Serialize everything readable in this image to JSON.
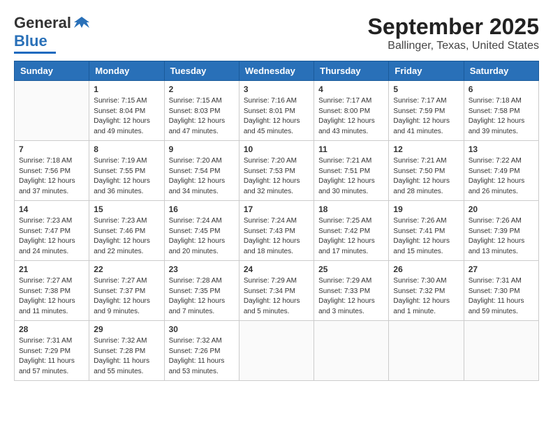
{
  "header": {
    "logo_line1": "General",
    "logo_line2": "Blue",
    "title": "September 2025",
    "subtitle": "Ballinger, Texas, United States"
  },
  "days_of_week": [
    "Sunday",
    "Monday",
    "Tuesday",
    "Wednesday",
    "Thursday",
    "Friday",
    "Saturday"
  ],
  "weeks": [
    [
      {
        "day": "",
        "content": ""
      },
      {
        "day": "1",
        "content": "Sunrise: 7:15 AM\nSunset: 8:04 PM\nDaylight: 12 hours\nand 49 minutes."
      },
      {
        "day": "2",
        "content": "Sunrise: 7:15 AM\nSunset: 8:03 PM\nDaylight: 12 hours\nand 47 minutes."
      },
      {
        "day": "3",
        "content": "Sunrise: 7:16 AM\nSunset: 8:01 PM\nDaylight: 12 hours\nand 45 minutes."
      },
      {
        "day": "4",
        "content": "Sunrise: 7:17 AM\nSunset: 8:00 PM\nDaylight: 12 hours\nand 43 minutes."
      },
      {
        "day": "5",
        "content": "Sunrise: 7:17 AM\nSunset: 7:59 PM\nDaylight: 12 hours\nand 41 minutes."
      },
      {
        "day": "6",
        "content": "Sunrise: 7:18 AM\nSunset: 7:58 PM\nDaylight: 12 hours\nand 39 minutes."
      }
    ],
    [
      {
        "day": "7",
        "content": "Sunrise: 7:18 AM\nSunset: 7:56 PM\nDaylight: 12 hours\nand 37 minutes."
      },
      {
        "day": "8",
        "content": "Sunrise: 7:19 AM\nSunset: 7:55 PM\nDaylight: 12 hours\nand 36 minutes."
      },
      {
        "day": "9",
        "content": "Sunrise: 7:20 AM\nSunset: 7:54 PM\nDaylight: 12 hours\nand 34 minutes."
      },
      {
        "day": "10",
        "content": "Sunrise: 7:20 AM\nSunset: 7:53 PM\nDaylight: 12 hours\nand 32 minutes."
      },
      {
        "day": "11",
        "content": "Sunrise: 7:21 AM\nSunset: 7:51 PM\nDaylight: 12 hours\nand 30 minutes."
      },
      {
        "day": "12",
        "content": "Sunrise: 7:21 AM\nSunset: 7:50 PM\nDaylight: 12 hours\nand 28 minutes."
      },
      {
        "day": "13",
        "content": "Sunrise: 7:22 AM\nSunset: 7:49 PM\nDaylight: 12 hours\nand 26 minutes."
      }
    ],
    [
      {
        "day": "14",
        "content": "Sunrise: 7:23 AM\nSunset: 7:47 PM\nDaylight: 12 hours\nand 24 minutes."
      },
      {
        "day": "15",
        "content": "Sunrise: 7:23 AM\nSunset: 7:46 PM\nDaylight: 12 hours\nand 22 minutes."
      },
      {
        "day": "16",
        "content": "Sunrise: 7:24 AM\nSunset: 7:45 PM\nDaylight: 12 hours\nand 20 minutes."
      },
      {
        "day": "17",
        "content": "Sunrise: 7:24 AM\nSunset: 7:43 PM\nDaylight: 12 hours\nand 18 minutes."
      },
      {
        "day": "18",
        "content": "Sunrise: 7:25 AM\nSunset: 7:42 PM\nDaylight: 12 hours\nand 17 minutes."
      },
      {
        "day": "19",
        "content": "Sunrise: 7:26 AM\nSunset: 7:41 PM\nDaylight: 12 hours\nand 15 minutes."
      },
      {
        "day": "20",
        "content": "Sunrise: 7:26 AM\nSunset: 7:39 PM\nDaylight: 12 hours\nand 13 minutes."
      }
    ],
    [
      {
        "day": "21",
        "content": "Sunrise: 7:27 AM\nSunset: 7:38 PM\nDaylight: 12 hours\nand 11 minutes."
      },
      {
        "day": "22",
        "content": "Sunrise: 7:27 AM\nSunset: 7:37 PM\nDaylight: 12 hours\nand 9 minutes."
      },
      {
        "day": "23",
        "content": "Sunrise: 7:28 AM\nSunset: 7:35 PM\nDaylight: 12 hours\nand 7 minutes."
      },
      {
        "day": "24",
        "content": "Sunrise: 7:29 AM\nSunset: 7:34 PM\nDaylight: 12 hours\nand 5 minutes."
      },
      {
        "day": "25",
        "content": "Sunrise: 7:29 AM\nSunset: 7:33 PM\nDaylight: 12 hours\nand 3 minutes."
      },
      {
        "day": "26",
        "content": "Sunrise: 7:30 AM\nSunset: 7:32 PM\nDaylight: 12 hours\nand 1 minute."
      },
      {
        "day": "27",
        "content": "Sunrise: 7:31 AM\nSunset: 7:30 PM\nDaylight: 11 hours\nand 59 minutes."
      }
    ],
    [
      {
        "day": "28",
        "content": "Sunrise: 7:31 AM\nSunset: 7:29 PM\nDaylight: 11 hours\nand 57 minutes."
      },
      {
        "day": "29",
        "content": "Sunrise: 7:32 AM\nSunset: 7:28 PM\nDaylight: 11 hours\nand 55 minutes."
      },
      {
        "day": "30",
        "content": "Sunrise: 7:32 AM\nSunset: 7:26 PM\nDaylight: 11 hours\nand 53 minutes."
      },
      {
        "day": "",
        "content": ""
      },
      {
        "day": "",
        "content": ""
      },
      {
        "day": "",
        "content": ""
      },
      {
        "day": "",
        "content": ""
      }
    ]
  ]
}
